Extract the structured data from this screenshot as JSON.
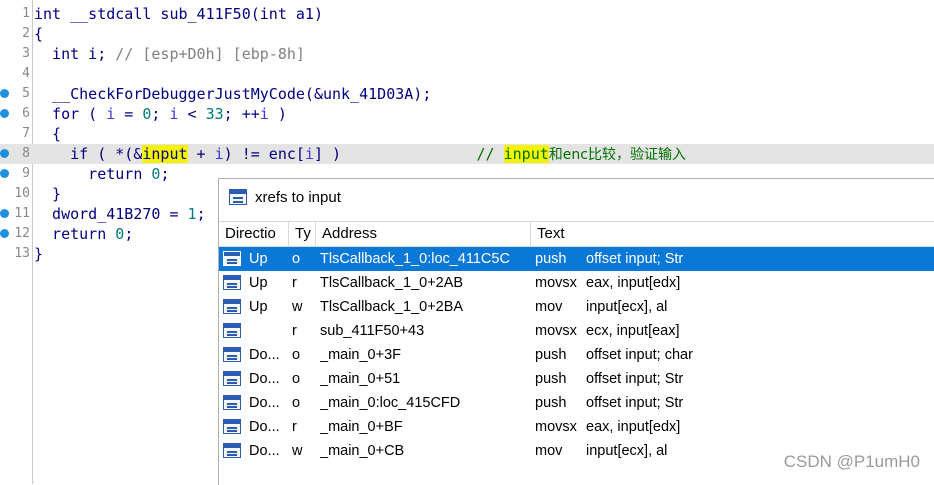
{
  "code": {
    "lines": [
      {
        "n": "1",
        "text": "int __stdcall sub_411F50(int a1)"
      },
      {
        "n": "2",
        "text": "{"
      },
      {
        "n": "3",
        "decl": "  int i;",
        "comment": " // [esp+D0h] [ebp-8h]"
      },
      {
        "n": "4",
        "text": ""
      },
      {
        "n": "5",
        "text": "  __CheckForDebuggerJustMyCode(&unk_41D03A);"
      },
      {
        "n": "6",
        "pre": "  for ( ",
        "v1": "i",
        "mid1": " = ",
        "num1": "0",
        "mid2": "; ",
        "v2": "i",
        "mid3": " < ",
        "num2": "33",
        "mid4": "; ++",
        "v3": "i",
        "post": " )"
      },
      {
        "n": "7",
        "text": "  {"
      },
      {
        "n": "8",
        "pre": "    if ( *(&",
        "hl": "input",
        "mid": " + ",
        "v": "i",
        "mid2": ") != enc[",
        "v2": "i",
        "post": "] )               ",
        "cmt_pre": "// ",
        "cmt_hl": "input",
        "cmt_post": "和enc比较，验证输入"
      },
      {
        "n": "9",
        "pre": "      return ",
        "num": "0",
        "post": ";"
      },
      {
        "n": "10",
        "text": "  }"
      },
      {
        "n": "11",
        "pre": "  dword_41B270 = ",
        "num": "1",
        "post": ";"
      },
      {
        "n": "12",
        "pre": "  return ",
        "num": "0",
        "post": ";"
      },
      {
        "n": "13",
        "text": "}"
      }
    ]
  },
  "xrefs": {
    "title": "xrefs to input",
    "columns": [
      "Directio",
      "Ty",
      "Address",
      "Text"
    ],
    "rows": [
      {
        "dir": "Up",
        "type": "o",
        "address": "TlsCallback_1_0:loc_411C5C",
        "mnem": "push",
        "operands": "offset input; Str"
      },
      {
        "dir": "Up",
        "type": "r",
        "address": "TlsCallback_1_0+2AB",
        "mnem": "movsx",
        "operands": "eax, input[edx]"
      },
      {
        "dir": "Up",
        "type": "w",
        "address": "TlsCallback_1_0+2BA",
        "mnem": "mov",
        "operands": "input[ecx], al"
      },
      {
        "dir": "",
        "type": "r",
        "address": "sub_411F50+43",
        "mnem": "movsx",
        "operands": "ecx, input[eax]"
      },
      {
        "dir": "Do...",
        "type": "o",
        "address": "_main_0+3F",
        "mnem": "push",
        "operands": "offset input; char"
      },
      {
        "dir": "Do...",
        "type": "o",
        "address": "_main_0+51",
        "mnem": "push",
        "operands": "offset input; Str"
      },
      {
        "dir": "Do...",
        "type": "o",
        "address": "_main_0:loc_415CFD",
        "mnem": "push",
        "operands": "offset input; Str"
      },
      {
        "dir": "Do...",
        "type": "r",
        "address": "_main_0+BF",
        "mnem": "movsx",
        "operands": "eax, input[edx]"
      },
      {
        "dir": "Do...",
        "type": "w",
        "address": "_main_0+CB",
        "mnem": "mov",
        "operands": "input[ecx], al"
      }
    ]
  },
  "watermark": "CSDN @P1umH0"
}
